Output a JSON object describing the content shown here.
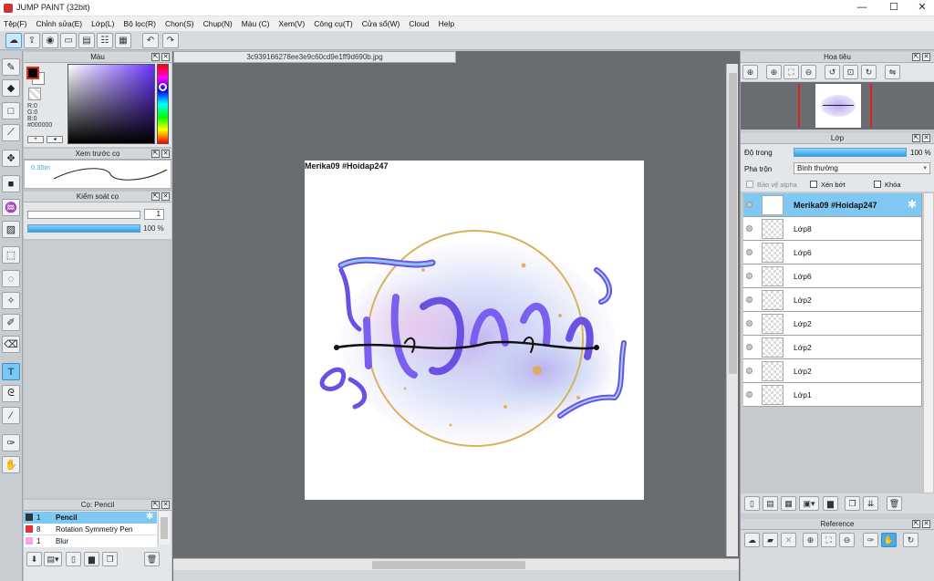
{
  "window": {
    "title": "JUMP PAINT (32bit)",
    "minimize": "—",
    "maximize": "☐",
    "close": "✕"
  },
  "menu": [
    "Tệp(F)",
    "Chỉnh sửa(E)",
    "Lớp(L)",
    "Bộ lọc(R)",
    "Chọn(S)",
    "Chụp(N)",
    "Màu (C)",
    "Xem(V)",
    "Công cụ(T)",
    "Cửa sổ(W)",
    "Cloud",
    "Help"
  ],
  "color_panel": {
    "title": "Màu",
    "r": "R:0",
    "g": "G:0",
    "b": "B:0",
    "hex": "#000000",
    "primary": "#000000",
    "secondary": "#ffffff"
  },
  "brush_preview": {
    "title": "Xem trước cọ",
    "size": "0.35m"
  },
  "brush_control": {
    "title": "Kiểm soát cọ",
    "size_value": "1",
    "opacity_value": "100 %"
  },
  "brush_list": {
    "title": "Cọ: Pencil",
    "items": [
      {
        "size": "1",
        "name": "Pencil",
        "color": "#333333",
        "selected": true
      },
      {
        "size": "8",
        "name": "Rotation Symmetry Pen",
        "color": "#e23434",
        "selected": false
      },
      {
        "size": "1",
        "name": "Blur",
        "color": "#f3a6ec",
        "selected": false
      }
    ]
  },
  "document": {
    "tab": "3c939166278ee3e9c60cd9e1ff9d690b.jpg",
    "canvas_caption": "Merika09 #Hoidap247"
  },
  "navigator": {
    "title": "Hoa tiêu"
  },
  "layers_panel": {
    "title": "Lớp",
    "opacity_label": "Độ trong",
    "opacity_value": "100 %",
    "blend_label": "Pha trộn",
    "blend_value": "Bình thường",
    "protect_alpha": "Bảo vệ alpha",
    "clipping": "Xén bớt",
    "lock": "Khóa",
    "layers": [
      "Merika09 #Hoidap247",
      "Lớp8",
      "Lớp6",
      "Lớp6",
      "Lớp2",
      "Lớp2",
      "Lớp2",
      "Lớp2",
      "Lớp1"
    ]
  },
  "reference": {
    "title": "Reference"
  },
  "colors": {
    "accent": "#7ec8f3",
    "panel": "#e4e7e9",
    "canvas_bg": "#696c71"
  }
}
